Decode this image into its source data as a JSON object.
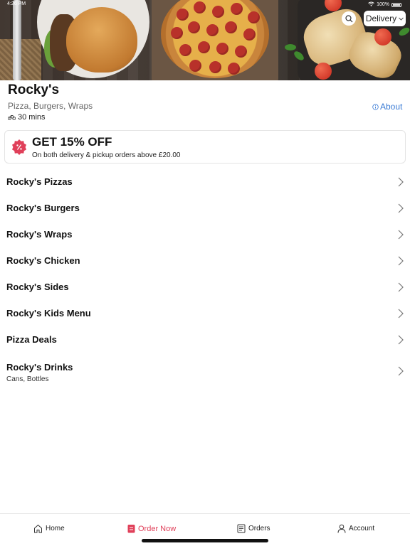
{
  "status_bar": {
    "time": "4:26 PM",
    "battery": "100%"
  },
  "header": {
    "delivery_label": "Delivery"
  },
  "restaurant": {
    "name": "Rocky's",
    "cuisine": "Pizza, Burgers, Wraps",
    "eta": "30 mins",
    "about_label": "About"
  },
  "offer": {
    "title": "GET 15% OFF",
    "subtitle": "On both delivery & pickup orders above £20.00",
    "badge_color": "#e0405a"
  },
  "menu": {
    "items": [
      {
        "name": "Rocky's Pizzas"
      },
      {
        "name": "Rocky's Burgers"
      },
      {
        "name": "Rocky's Wraps"
      },
      {
        "name": "Rocky's Chicken"
      },
      {
        "name": "Rocky's Sides"
      },
      {
        "name": "Rocky's Kids Menu"
      },
      {
        "name": "Pizza Deals"
      },
      {
        "name": "Rocky's Drinks",
        "subtitle": "Cans, Bottles"
      }
    ]
  },
  "tabs": [
    {
      "label": "Home",
      "icon": "home-icon"
    },
    {
      "label": "Order Now",
      "icon": "order-icon"
    },
    {
      "label": "Orders",
      "icon": "receipt-icon"
    },
    {
      "label": "Account",
      "icon": "user-icon"
    }
  ],
  "colors": {
    "accent": "#e0405a",
    "link": "#3a7bd5"
  }
}
